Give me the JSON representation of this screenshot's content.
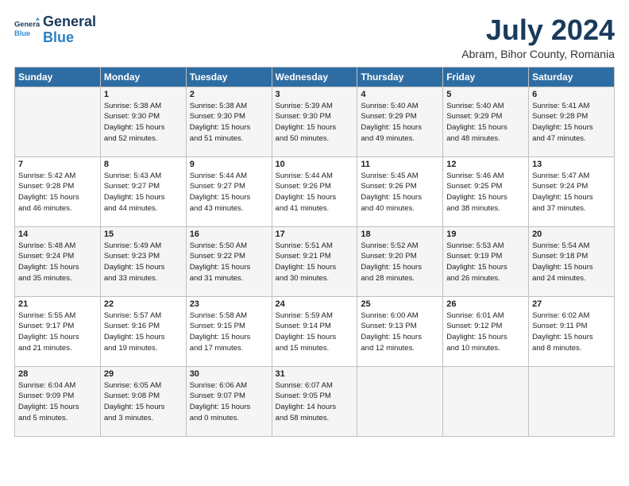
{
  "header": {
    "logo_line1": "General",
    "logo_line2": "Blue",
    "month": "July 2024",
    "location": "Abram, Bihor County, Romania"
  },
  "weekdays": [
    "Sunday",
    "Monday",
    "Tuesday",
    "Wednesday",
    "Thursday",
    "Friday",
    "Saturday"
  ],
  "weeks": [
    [
      {
        "day": "",
        "info": ""
      },
      {
        "day": "1",
        "info": "Sunrise: 5:38 AM\nSunset: 9:30 PM\nDaylight: 15 hours\nand 52 minutes."
      },
      {
        "day": "2",
        "info": "Sunrise: 5:38 AM\nSunset: 9:30 PM\nDaylight: 15 hours\nand 51 minutes."
      },
      {
        "day": "3",
        "info": "Sunrise: 5:39 AM\nSunset: 9:30 PM\nDaylight: 15 hours\nand 50 minutes."
      },
      {
        "day": "4",
        "info": "Sunrise: 5:40 AM\nSunset: 9:29 PM\nDaylight: 15 hours\nand 49 minutes."
      },
      {
        "day": "5",
        "info": "Sunrise: 5:40 AM\nSunset: 9:29 PM\nDaylight: 15 hours\nand 48 minutes."
      },
      {
        "day": "6",
        "info": "Sunrise: 5:41 AM\nSunset: 9:28 PM\nDaylight: 15 hours\nand 47 minutes."
      }
    ],
    [
      {
        "day": "7",
        "info": "Sunrise: 5:42 AM\nSunset: 9:28 PM\nDaylight: 15 hours\nand 46 minutes."
      },
      {
        "day": "8",
        "info": "Sunrise: 5:43 AM\nSunset: 9:27 PM\nDaylight: 15 hours\nand 44 minutes."
      },
      {
        "day": "9",
        "info": "Sunrise: 5:44 AM\nSunset: 9:27 PM\nDaylight: 15 hours\nand 43 minutes."
      },
      {
        "day": "10",
        "info": "Sunrise: 5:44 AM\nSunset: 9:26 PM\nDaylight: 15 hours\nand 41 minutes."
      },
      {
        "day": "11",
        "info": "Sunrise: 5:45 AM\nSunset: 9:26 PM\nDaylight: 15 hours\nand 40 minutes."
      },
      {
        "day": "12",
        "info": "Sunrise: 5:46 AM\nSunset: 9:25 PM\nDaylight: 15 hours\nand 38 minutes."
      },
      {
        "day": "13",
        "info": "Sunrise: 5:47 AM\nSunset: 9:24 PM\nDaylight: 15 hours\nand 37 minutes."
      }
    ],
    [
      {
        "day": "14",
        "info": "Sunrise: 5:48 AM\nSunset: 9:24 PM\nDaylight: 15 hours\nand 35 minutes."
      },
      {
        "day": "15",
        "info": "Sunrise: 5:49 AM\nSunset: 9:23 PM\nDaylight: 15 hours\nand 33 minutes."
      },
      {
        "day": "16",
        "info": "Sunrise: 5:50 AM\nSunset: 9:22 PM\nDaylight: 15 hours\nand 31 minutes."
      },
      {
        "day": "17",
        "info": "Sunrise: 5:51 AM\nSunset: 9:21 PM\nDaylight: 15 hours\nand 30 minutes."
      },
      {
        "day": "18",
        "info": "Sunrise: 5:52 AM\nSunset: 9:20 PM\nDaylight: 15 hours\nand 28 minutes."
      },
      {
        "day": "19",
        "info": "Sunrise: 5:53 AM\nSunset: 9:19 PM\nDaylight: 15 hours\nand 26 minutes."
      },
      {
        "day": "20",
        "info": "Sunrise: 5:54 AM\nSunset: 9:18 PM\nDaylight: 15 hours\nand 24 minutes."
      }
    ],
    [
      {
        "day": "21",
        "info": "Sunrise: 5:55 AM\nSunset: 9:17 PM\nDaylight: 15 hours\nand 21 minutes."
      },
      {
        "day": "22",
        "info": "Sunrise: 5:57 AM\nSunset: 9:16 PM\nDaylight: 15 hours\nand 19 minutes."
      },
      {
        "day": "23",
        "info": "Sunrise: 5:58 AM\nSunset: 9:15 PM\nDaylight: 15 hours\nand 17 minutes."
      },
      {
        "day": "24",
        "info": "Sunrise: 5:59 AM\nSunset: 9:14 PM\nDaylight: 15 hours\nand 15 minutes."
      },
      {
        "day": "25",
        "info": "Sunrise: 6:00 AM\nSunset: 9:13 PM\nDaylight: 15 hours\nand 12 minutes."
      },
      {
        "day": "26",
        "info": "Sunrise: 6:01 AM\nSunset: 9:12 PM\nDaylight: 15 hours\nand 10 minutes."
      },
      {
        "day": "27",
        "info": "Sunrise: 6:02 AM\nSunset: 9:11 PM\nDaylight: 15 hours\nand 8 minutes."
      }
    ],
    [
      {
        "day": "28",
        "info": "Sunrise: 6:04 AM\nSunset: 9:09 PM\nDaylight: 15 hours\nand 5 minutes."
      },
      {
        "day": "29",
        "info": "Sunrise: 6:05 AM\nSunset: 9:08 PM\nDaylight: 15 hours\nand 3 minutes."
      },
      {
        "day": "30",
        "info": "Sunrise: 6:06 AM\nSunset: 9:07 PM\nDaylight: 15 hours\nand 0 minutes."
      },
      {
        "day": "31",
        "info": "Sunrise: 6:07 AM\nSunset: 9:05 PM\nDaylight: 14 hours\nand 58 minutes."
      },
      {
        "day": "",
        "info": ""
      },
      {
        "day": "",
        "info": ""
      },
      {
        "day": "",
        "info": ""
      }
    ]
  ]
}
